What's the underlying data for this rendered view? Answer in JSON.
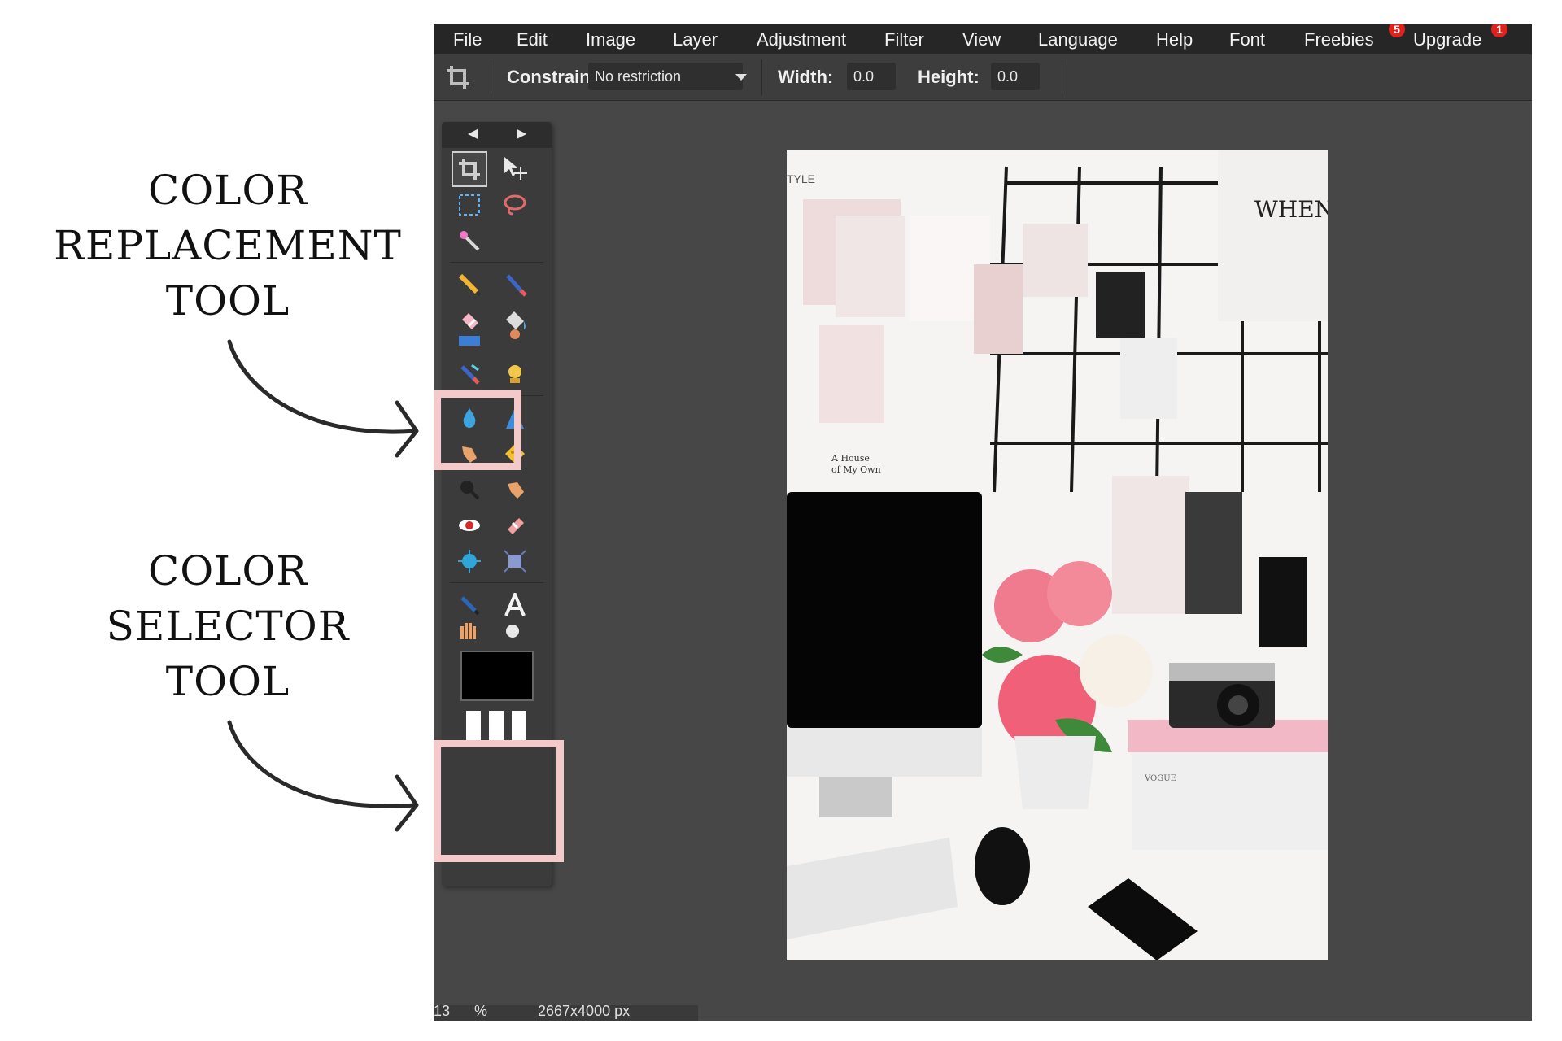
{
  "annotations": {
    "replacement": [
      "COLOR",
      "REPLACEMENT",
      "TOOL"
    ],
    "selector": [
      "COLOR",
      "SELECTOR",
      "TOOL"
    ]
  },
  "menu": {
    "items": [
      "File",
      "Edit",
      "Image",
      "Layer",
      "Adjustment",
      "Filter",
      "View",
      "Language",
      "Help",
      "Font",
      "Freebies",
      "Upgrade"
    ],
    "freebies_badge": "5",
    "upgrade_badge": "1"
  },
  "options": {
    "constraint_label": "Constraint:",
    "constraint_value": "No restriction",
    "width_label": "Width:",
    "width_value": "0.0",
    "height_label": "Height:",
    "height_value": "0.0"
  },
  "canvas_text": {
    "when": "WHEN",
    "style": "TYLE",
    "book_line1": "A House",
    "book_line2": "of My Own",
    "vogue": "VOGUE"
  },
  "status": {
    "zoom": "13",
    "percent": "%",
    "size": "2667x4000 px"
  },
  "colors": {
    "highlight": "#f4c9c9",
    "app_bg": "#474747",
    "menubar": "#262626",
    "foreground_color": "#000000",
    "badge": "#e0211d"
  }
}
